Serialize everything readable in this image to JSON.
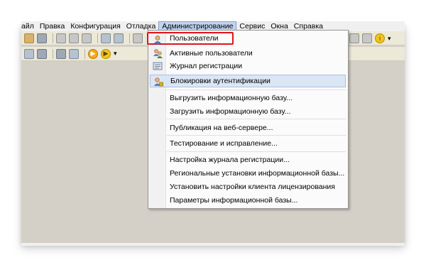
{
  "menubar": {
    "items": [
      "айл",
      "Правка",
      "Конфигурация",
      "Отладка",
      "Администрирование",
      "Сервис",
      "Окна",
      "Справка"
    ]
  },
  "icons": {
    "users": "user-icon",
    "active_users": "active-users-icon",
    "log": "log-journal-icon",
    "auth_lock": "user-lock-icon"
  },
  "colors": {
    "highlight_box": "#e1131c",
    "menu_hover": "#dbe6f4",
    "app_background": "#d4d0c8"
  },
  "admin_menu": {
    "items": [
      {
        "label": "Пользователи"
      },
      {
        "label": "Активные пользователи"
      },
      {
        "label": "Журнал регистрации"
      },
      {
        "label": "Блокировки аутентификации"
      },
      {
        "label": "Выгрузить информационную базу..."
      },
      {
        "label": "Загрузить информационную базу..."
      },
      {
        "label": "Публикация на веб-сервере..."
      },
      {
        "label": "Тестирование и исправление..."
      },
      {
        "label": "Настройка журнала регистрации..."
      },
      {
        "label": "Региональные установки информационной базы..."
      },
      {
        "label": "Установить настройки клиента лицензирования"
      },
      {
        "label": "Параметры информационной базы..."
      }
    ]
  }
}
